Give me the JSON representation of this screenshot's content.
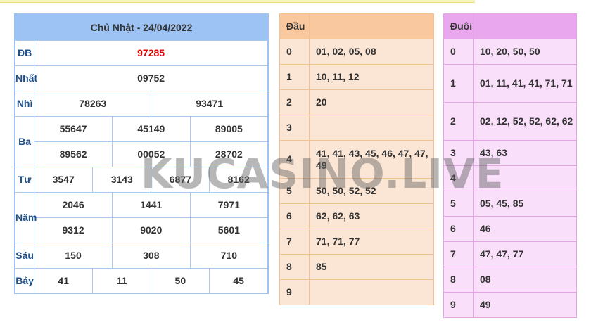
{
  "results": {
    "title": "Chủ Nhật - 24/04/2022",
    "db": {
      "label": "ĐB",
      "values": [
        "97285"
      ]
    },
    "nhat": {
      "label": "Nhất",
      "values": [
        "09752"
      ]
    },
    "nhi": {
      "label": "Nhì",
      "values": [
        "78263",
        "93471"
      ]
    },
    "ba": {
      "label": "Ba",
      "values": [
        "55647",
        "45149",
        "89005",
        "89562",
        "00052",
        "28702"
      ]
    },
    "tu": {
      "label": "Tư",
      "values": [
        "3547",
        "3143",
        "6877",
        "8162"
      ]
    },
    "nam": {
      "label": "Năm",
      "values": [
        "2046",
        "1441",
        "7971",
        "9312",
        "9020",
        "5601"
      ]
    },
    "sau": {
      "label": "Sáu",
      "values": [
        "150",
        "308",
        "710"
      ]
    },
    "bay": {
      "label": "Bảy",
      "values": [
        "41",
        "11",
        "50",
        "45"
      ]
    }
  },
  "dau": {
    "header": "Đầu",
    "rows": [
      {
        "digit": "0",
        "values": "01, 02, 05, 08"
      },
      {
        "digit": "1",
        "values": "10, 11, 12"
      },
      {
        "digit": "2",
        "values": "20"
      },
      {
        "digit": "3",
        "values": ""
      },
      {
        "digit": "4",
        "values": "41, 41, 43, 45, 46, 47, 47, 49"
      },
      {
        "digit": "5",
        "values": "50, 50, 52, 52"
      },
      {
        "digit": "6",
        "values": "62, 62, 63"
      },
      {
        "digit": "7",
        "values": "71, 71, 77"
      },
      {
        "digit": "8",
        "values": "85"
      },
      {
        "digit": "9",
        "values": ""
      }
    ]
  },
  "duoi": {
    "header": "Đuôi",
    "rows": [
      {
        "digit": "0",
        "values": "10, 20, 50, 50"
      },
      {
        "digit": "1",
        "values": "01, 11, 41, 41, 71, 71"
      },
      {
        "digit": "2",
        "values": "02, 12, 52, 52, 62, 62"
      },
      {
        "digit": "3",
        "values": "43, 63"
      },
      {
        "digit": "4",
        "values": ""
      },
      {
        "digit": "5",
        "values": "05, 45, 85"
      },
      {
        "digit": "6",
        "values": "46"
      },
      {
        "digit": "7",
        "values": "47, 47, 77"
      },
      {
        "digit": "8",
        "values": "08"
      },
      {
        "digit": "9",
        "values": "49"
      }
    ]
  },
  "watermark": "KUCASINO.LIVE",
  "colors": {
    "results_header": "#9cc3f4",
    "label_text": "#1f4f8a",
    "special_prize": "#e00000",
    "dau_header": "#f9c89f",
    "dau_cell": "#fbe6d5",
    "duoi_header": "#e9a7ee",
    "duoi_cell": "#f9dff9"
  }
}
